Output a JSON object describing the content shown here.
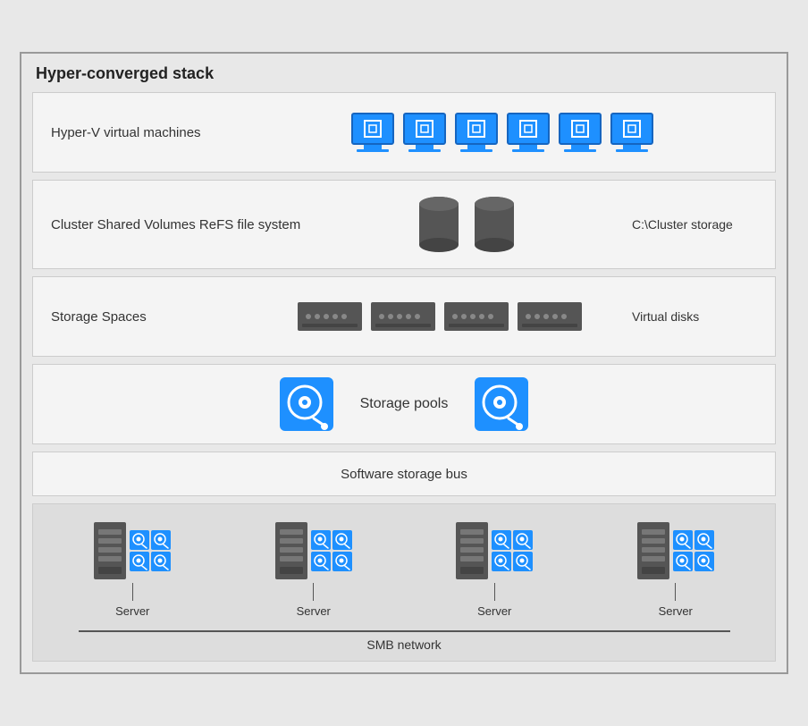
{
  "diagram": {
    "title": "Hyper-converged stack",
    "layers": {
      "hyperv": {
        "label": "Hyper-V virtual machines",
        "vm_count": 6
      },
      "csv": {
        "label": "Cluster Shared Volumes ReFS file system",
        "right_label": "C:\\Cluster storage",
        "db_count": 2
      },
      "storage_spaces": {
        "label": "Storage Spaces",
        "right_label": "Virtual disks",
        "nas_count": 4
      },
      "storage_pools": {
        "label": "Storage pools",
        "hdd_count": 2
      },
      "software_bus": {
        "label": "Software storage bus"
      },
      "servers": {
        "nodes": [
          {
            "label": "Server"
          },
          {
            "label": "Server"
          },
          {
            "label": "Server"
          },
          {
            "label": "Server"
          }
        ]
      },
      "smb": {
        "label": "SMB network"
      }
    }
  }
}
